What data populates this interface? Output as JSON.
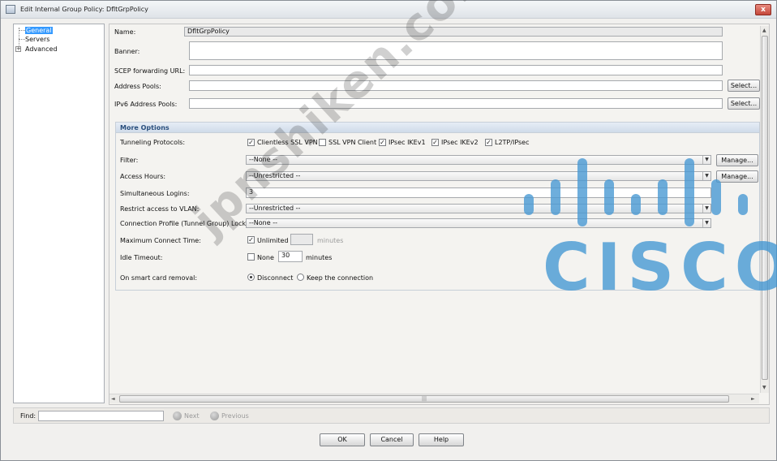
{
  "window": {
    "title": "Edit Internal Group Policy: DfltGrpPolicy",
    "close_glyph": "x"
  },
  "tree": {
    "items": [
      {
        "label": "General",
        "selected": true
      },
      {
        "label": "Servers"
      },
      {
        "label": "Advanced",
        "expander": "+"
      }
    ]
  },
  "form": {
    "name_label": "Name:",
    "name_value": "DfltGrpPolicy",
    "banner_label": "Banner:",
    "banner_value": "",
    "scep_label": "SCEP forwarding URL:",
    "scep_value": "",
    "address_pools_label": "Address Pools:",
    "address_pools_value": "",
    "address_pools_button": "Select...",
    "ipv6_pools_label": "IPv6 Address Pools:",
    "ipv6_pools_value": "",
    "ipv6_pools_button": "Select..."
  },
  "more_options": {
    "title": "More Options",
    "tunneling_label": "Tunneling Protocols:",
    "protocols": [
      {
        "label": "Clientless SSL VPN",
        "checked": true
      },
      {
        "label": "SSL VPN Client",
        "checked": false
      },
      {
        "label": "IPsec IKEv1",
        "checked": true
      },
      {
        "label": "IPsec IKEv2",
        "checked": true
      },
      {
        "label": "L2TP/IPsec",
        "checked": true
      }
    ],
    "check_glyph": "✓",
    "filter_label": "Filter:",
    "filter_value": "--None --",
    "filter_button": "Manage...",
    "access_hours_label": "Access Hours:",
    "access_hours_value": "--Unrestricted --",
    "access_hours_button": "Manage...",
    "sim_logins_label": "Simultaneous Logins:",
    "sim_logins_value": "3",
    "vlan_label": "Restrict access to VLAN:",
    "vlan_value": "--Unrestricted --",
    "conn_profile_label": "Connection Profile (Tunnel Group) Lock:",
    "conn_profile_value": "--None --",
    "max_connect_label": "Maximum Connect Time:",
    "max_connect_unlimited": "Unlimited",
    "max_connect_unlimited_checked": true,
    "max_connect_value": "",
    "max_connect_unit": "minutes",
    "idle_label": "Idle Timeout:",
    "idle_none": "None",
    "idle_none_checked": false,
    "idle_value": "30",
    "idle_unit": "minutes",
    "smartcard_label": "On smart card removal:",
    "smartcard_disconnect": "Disconnect",
    "smartcard_keep": "Keep the connection",
    "smartcard_selected": "Disconnect"
  },
  "scroll": {
    "up": "▲",
    "down": "▼",
    "left": "◄",
    "right": "►",
    "grip": "|||"
  },
  "findbar": {
    "find_label": "Find:",
    "find_value": "",
    "next_label": "Next",
    "previous_label": "Previous"
  },
  "buttons": {
    "ok": "OK",
    "cancel": "Cancel",
    "help": "Help"
  },
  "overlays": {
    "watermark": "jpnshiken.com",
    "logo_text": "CISCO",
    "logo_color": "#4a9ad4"
  }
}
